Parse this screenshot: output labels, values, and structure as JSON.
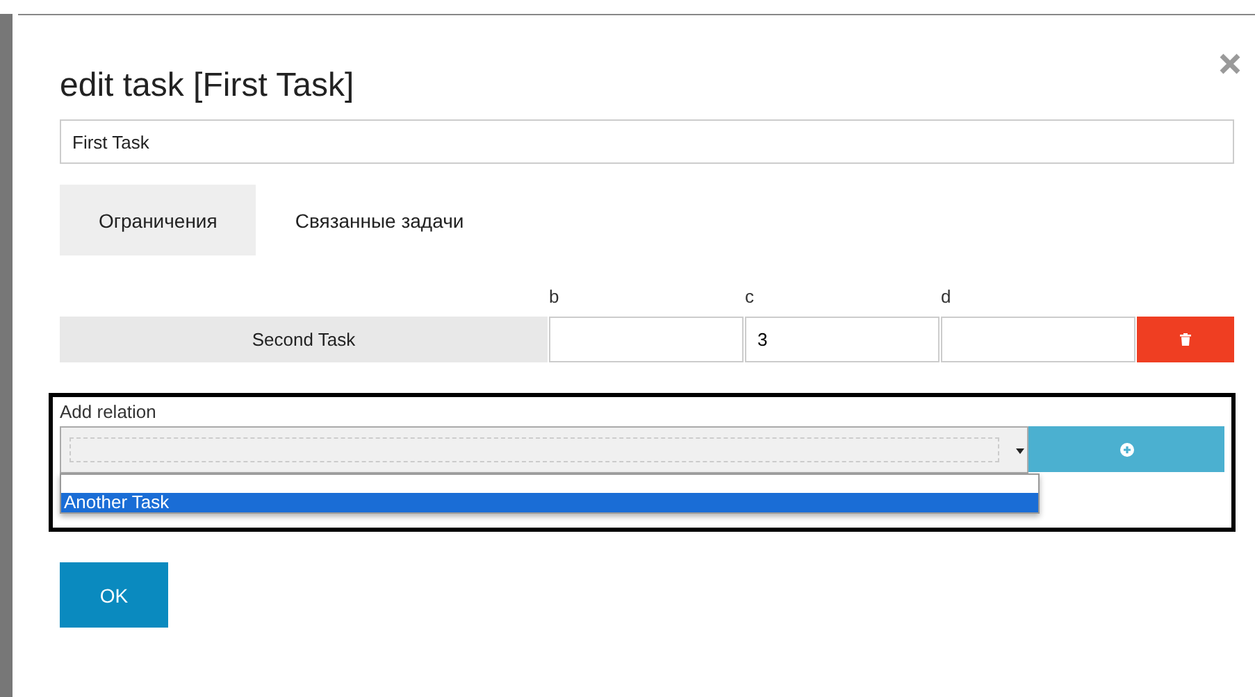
{
  "dialog": {
    "title": "edit task [First Task]",
    "name_field": {
      "value": "First Task"
    },
    "tabs": [
      {
        "label": "Ограничения",
        "selected": true
      },
      {
        "label": "Связанные задачи",
        "selected": false
      }
    ],
    "relations_table": {
      "columns": [
        "b",
        "c",
        "d"
      ],
      "rows": [
        {
          "task": "Second Task",
          "cells": [
            {},
            {
              "value": "3"
            },
            {}
          ]
        }
      ]
    },
    "add_relation": {
      "label": "Add relation",
      "dropdown": {
        "expanded": true,
        "options": [
          {
            "selected": false
          },
          {
            "label": "Another Task",
            "selected": true
          }
        ]
      }
    },
    "buttons": [
      "OK"
    ]
  }
}
